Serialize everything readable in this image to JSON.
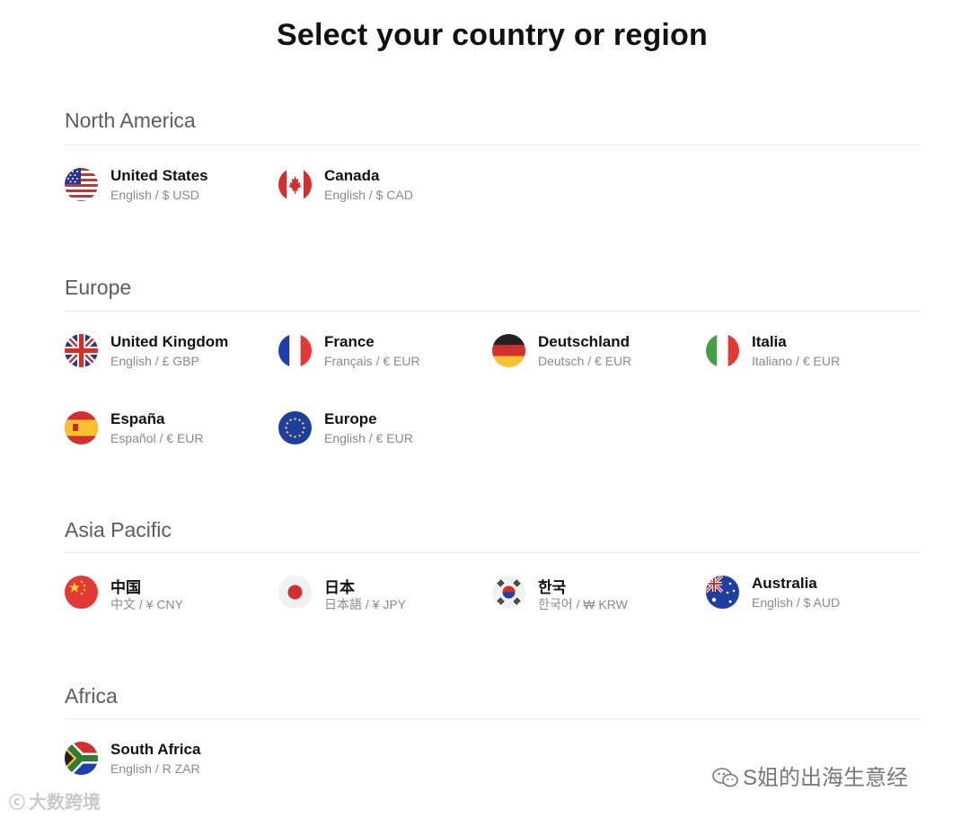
{
  "page": {
    "title": "Select your country or region"
  },
  "regions": [
    {
      "name": "North America",
      "countries": [
        {
          "name": "United States",
          "sub": "English / $ USD",
          "flag": "us-flag-icon"
        },
        {
          "name": "Canada",
          "sub": "English / $ CAD",
          "flag": "ca-flag-icon"
        }
      ]
    },
    {
      "name": "Europe",
      "countries": [
        {
          "name": "United Kingdom",
          "sub": "English / £ GBP",
          "flag": "gb-flag-icon"
        },
        {
          "name": "France",
          "sub": "Français / € EUR",
          "flag": "fr-flag-icon"
        },
        {
          "name": "Deutschland",
          "sub": "Deutsch / € EUR",
          "flag": "de-flag-icon"
        },
        {
          "name": "Italia",
          "sub": "Italiano / € EUR",
          "flag": "it-flag-icon"
        },
        {
          "name": "España",
          "sub": "Español / € EUR",
          "flag": "es-flag-icon"
        },
        {
          "name": "Europe",
          "sub": "English / € EUR",
          "flag": "eu-flag-icon"
        }
      ]
    },
    {
      "name": "Asia Pacific",
      "countries": [
        {
          "name": "中国",
          "sub": "中文 / ¥ CNY",
          "flag": "cn-flag-icon"
        },
        {
          "name": "日本",
          "sub": "日本語 / ¥ JPY",
          "flag": "jp-flag-icon"
        },
        {
          "name": "한국",
          "sub": "한국어 / ₩ KRW",
          "flag": "kr-flag-icon"
        },
        {
          "name": "Australia",
          "sub": "English / $ AUD",
          "flag": "au-flag-icon"
        }
      ]
    },
    {
      "name": "Africa",
      "countries": [
        {
          "name": "South Africa",
          "sub": "English / R ZAR",
          "flag": "za-flag-icon"
        }
      ]
    }
  ],
  "watermarks": {
    "left": "大数跨境",
    "right": "S姐的出海生意经"
  },
  "colors": {
    "heading": "#5d5d5d",
    "divider": "#e6e6e6",
    "subtext": "#8a8a8a"
  }
}
